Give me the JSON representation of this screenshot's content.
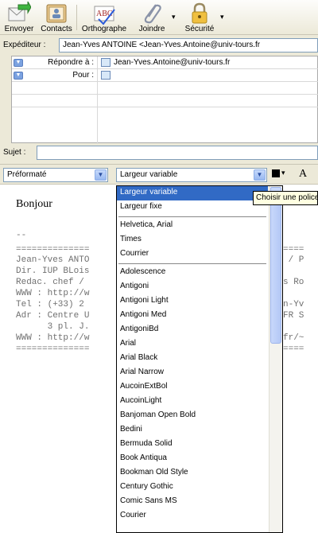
{
  "toolbar": {
    "send_label": "Envoyer",
    "contacts_label": "Contacts",
    "spelling_label": "Orthographe",
    "spelling_badge": "ABC",
    "attach_label": "Joindre",
    "security_label": "Sécurité"
  },
  "sender": {
    "label": "Expéditeur :",
    "value": "Jean-Yves ANTOINE <Jean-Yves.Antoine@univ-tours.fr"
  },
  "recipients": {
    "rows": [
      {
        "type": "Répondre à :",
        "address": "Jean-Yves.Antoine@univ-tours.fr"
      },
      {
        "type": "Pour :",
        "address": ""
      }
    ]
  },
  "subject": {
    "label": "Sujet :",
    "value": ""
  },
  "format_bar": {
    "paragraph_style": "Préformaté",
    "font_select": "Largeur variable",
    "text_size_glyph": "A"
  },
  "message": {
    "greeting": "Bonjour",
    "signature_left": [
      "--",
      "==============",
      "Jean-Yves ANTO",
      "Dir. IUP BLois",
      "Redac. chef /",
      "WWW : http://w",
      "Tel : (+33) 2",
      "Adr : Centre U",
      "      3 pl. J.",
      "WWW : http://w",
      "=============="
    ],
    "signature_right": [
      "",
      "====",
      " / P",
      "",
      "s Ro",
      "",
      "n-Yv",
      "FR S",
      "",
      "fr/~",
      "===="
    ]
  },
  "font_menu": {
    "selected": "Largeur variable",
    "items": [
      "Largeur variable",
      "Largeur fixe",
      "Helvetica, Arial",
      "Times",
      "Courrier",
      "Adolescence",
      "Antigoni",
      "Antigoni Light",
      "Antigoni Med",
      "AntigoniBd",
      "Arial",
      "Arial Black",
      "Arial Narrow",
      "AucoinExtBol",
      "AucoinLight",
      "Banjoman Open Bold",
      "Bedini",
      "Bermuda Solid",
      "Book Antiqua",
      "Bookman Old Style",
      "Century Gothic",
      "Comic Sans MS",
      "Courier"
    ]
  },
  "tooltip": "Choisir une police"
}
